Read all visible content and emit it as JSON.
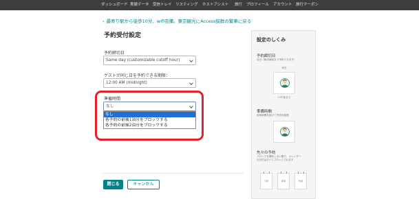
{
  "topnav": {
    "items": [
      "ダッシュボード",
      "実績データ",
      "受信トレイ",
      "リスティング",
      "ホストアシスト",
      "旅行",
      "プロフィール",
      "アカウント",
      "旅行クーポン"
    ]
  },
  "back_link": "最寄り駅から徒歩10分、wifi完備。東京観光にAccess抜群の繁華に戻る",
  "page_title": "予約受付設定",
  "fields": {
    "cutoff_label": "予約締切日",
    "cutoff_value": "Same day (customizable cutoff hour)",
    "sameday_label": "ゲストが同じ日を予約できる期限：",
    "sameday_value": "12:00 AM (midnight)",
    "prep_label": "準備時間",
    "prep_value": "なし"
  },
  "prep_options": [
    "なし",
    "各予約の前後1泊分をブロックする",
    "各予約の前後2泊分をブロックする"
  ],
  "buttons": {
    "close": "閉じる",
    "cancel": "キャンセル"
  },
  "side_panel": {
    "title": "設定のしくみ",
    "cutoff_heading": "予約締切日",
    "cutoff_desc": "当日（締切時刻まで予約できます）",
    "today_label": "本日",
    "cutoff_time": "12午前まで",
    "prep_heading": "準備時間",
    "prep_desc": "前後時間を設けて予約を制限",
    "advance_heading": "先々の予約",
    "advance_desc_1": "ブロックを解除しない限り、カレンダー",
    "advance_desc_2": "の日付はすべてブロックされます",
    "months": [
      "7月",
      "8月",
      "9月"
    ]
  },
  "colors": {
    "accent": "#008489",
    "nav_bg": "#3d3d3d",
    "highlight": "#e0202a",
    "selected_option": "#1e6fd6"
  },
  "icons": {
    "back": "chevron-left-icon",
    "dropdown": "chevron-down-icon",
    "avatar": "host-avatar-icon",
    "calendar": "calendar-page-icon"
  }
}
